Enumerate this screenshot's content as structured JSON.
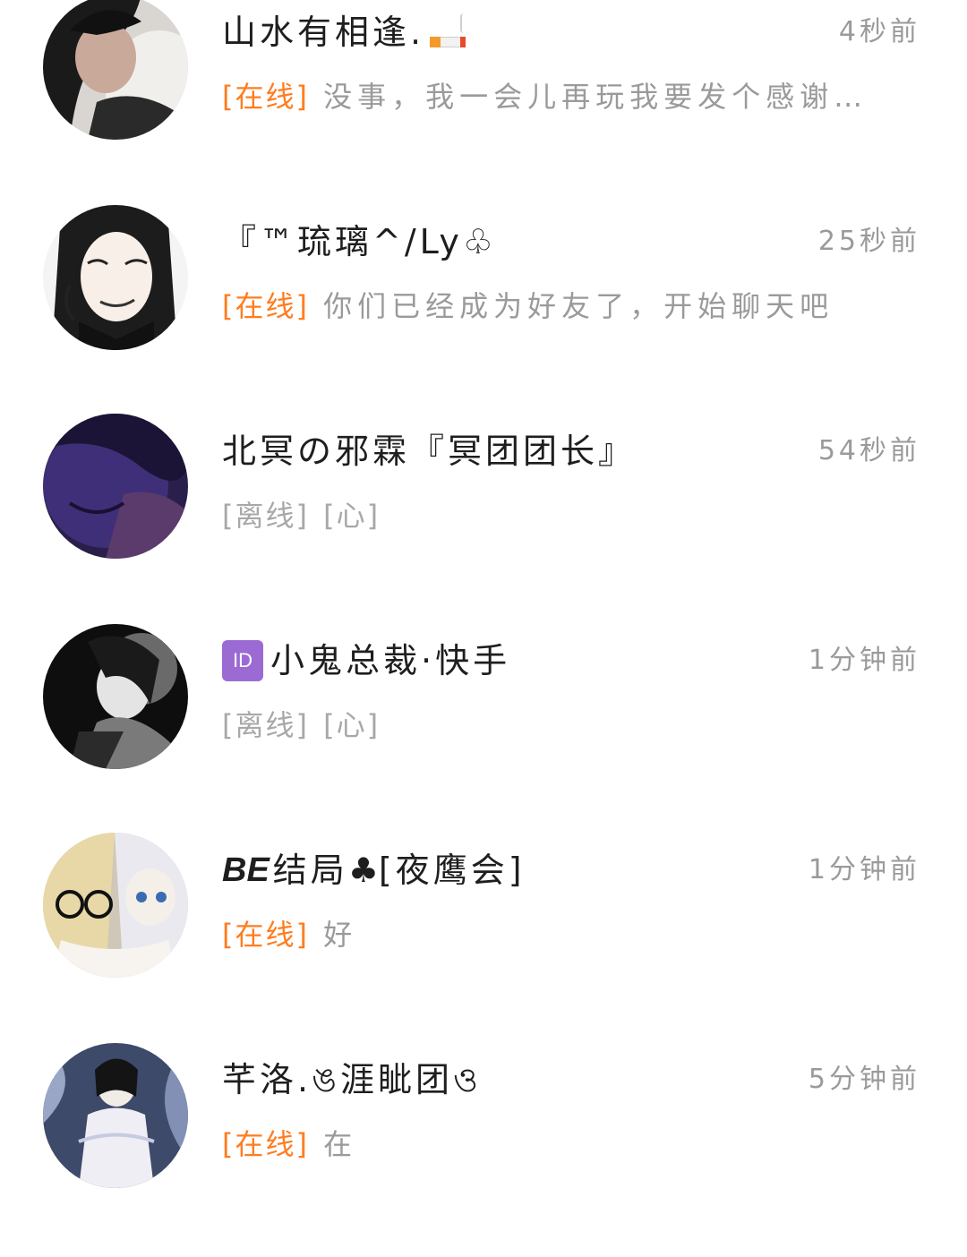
{
  "contacts": [
    {
      "name": "山水有相逢.",
      "name_icon": "cigarette-emoji-icon",
      "time": "4秒前",
      "status": "[在线]",
      "status_type": "online",
      "message": "没事，我一会儿再玩我要发个感谢…",
      "avatar": "avatar-photo-person-lying-down"
    },
    {
      "name": "『™琉璃^/Ly♧",
      "time": "25秒前",
      "status": "[在线]",
      "status_type": "online",
      "message": "你们已经成为好友了，开始聊天吧",
      "avatar": "avatar-anime-character-smirking"
    },
    {
      "name": "北冥の邪霖『冥团团长』",
      "time": "54秒前",
      "status": "[离线]",
      "status_type": "offline",
      "message": "[心]",
      "avatar": "avatar-dark-purple-illustration"
    },
    {
      "badge": "ID",
      "name": "小鬼总裁·快手",
      "time": "1分钟前",
      "status": "[离线]",
      "status_type": "offline",
      "message": "[心]",
      "avatar": "avatar-dark-photo-girl"
    },
    {
      "name_prefix": "BE",
      "name": "结局",
      "name_suit": "♣",
      "name_suffix": "[夜鹰会]",
      "time": "1分钟前",
      "status": "[在线]",
      "status_type": "online",
      "message": "好",
      "avatar": "avatar-two-dolls"
    },
    {
      "name": "芊洛.ঙ涯眦团ও",
      "time": "5分钟前",
      "status": "[在线]",
      "status_type": "online",
      "message": "在",
      "avatar": "avatar-girl-with-dragon"
    }
  ],
  "colors": {
    "online": "#ff7d1f",
    "offline": "#a8a8a8",
    "name": "#1e1e1e",
    "meta": "#9a9a9a",
    "id_badge": "#9b6bd3"
  }
}
